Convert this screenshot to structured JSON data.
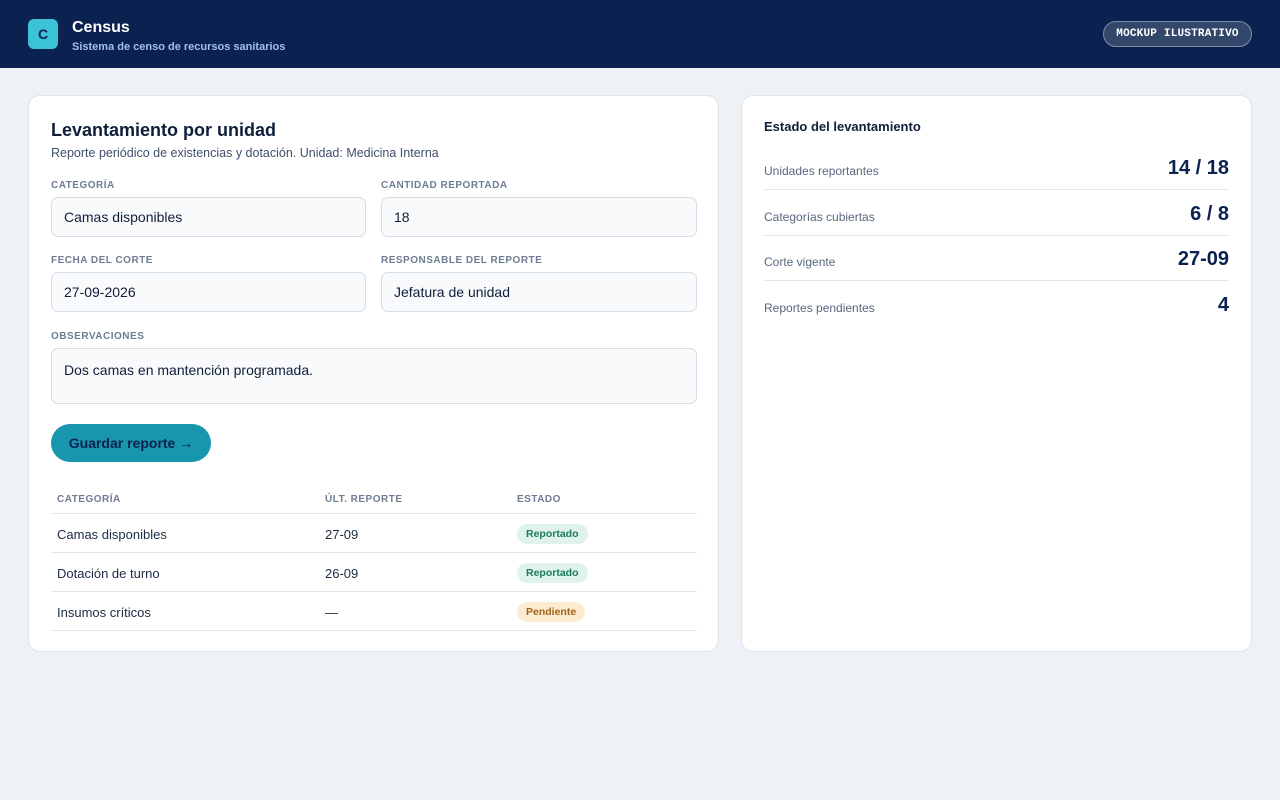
{
  "header": {
    "logo_letter": "C",
    "title": "Census",
    "subtitle": "Sistema de censo de recursos sanitarios",
    "badge": "MOCKUP ILUSTRATIVO"
  },
  "form": {
    "title": "Levantamiento por unidad",
    "subtitle": "Reporte periódico de existencias y dotación. Unidad: Medicina Interna",
    "fields": {
      "categoria": {
        "label": "CATEGORÍA",
        "value": "Camas disponibles"
      },
      "cantidad": {
        "label": "CANTIDAD REPORTADA",
        "value": "18"
      },
      "fecha": {
        "label": "FECHA DEL CORTE",
        "value": "27-09-2026"
      },
      "responsable": {
        "label": "RESPONSABLE DEL REPORTE",
        "value": "Jefatura de unidad"
      },
      "observaciones": {
        "label": "OBSERVACIONES",
        "value": "Dos camas en mantención programada."
      }
    },
    "save_label": "Guardar reporte →"
  },
  "table": {
    "headers": [
      "CATEGORÍA",
      "ÚLT. REPORTE",
      "ESTADO"
    ],
    "rows": [
      {
        "categoria": "Camas disponibles",
        "ultimo": "27-09",
        "estado": "Reportado",
        "status": "ok"
      },
      {
        "categoria": "Dotación de turno",
        "ultimo": "26-09",
        "estado": "Reportado",
        "status": "ok"
      },
      {
        "categoria": "Insumos críticos",
        "ultimo": "—",
        "estado": "Pendiente",
        "status": "pending"
      }
    ]
  },
  "status_panel": {
    "title": "Estado del levantamiento",
    "stats": [
      {
        "label": "Unidades reportantes",
        "value": "14 / 18"
      },
      {
        "label": "Categorías cubiertas",
        "value": "6 / 8"
      },
      {
        "label": "Corte vigente",
        "value": "27-09"
      },
      {
        "label": "Reportes pendientes",
        "value": "4"
      }
    ]
  },
  "colors": {
    "header_bg": "#0b2150",
    "accent": "#1796ad",
    "logo_bg": "#3cc2d6",
    "page_bg": "#eef2f6",
    "status_ok_bg": "#dff3ec",
    "status_ok_text": "#1b7c56",
    "status_pending_bg": "#fcebd0",
    "status_pending_text": "#a06314"
  }
}
